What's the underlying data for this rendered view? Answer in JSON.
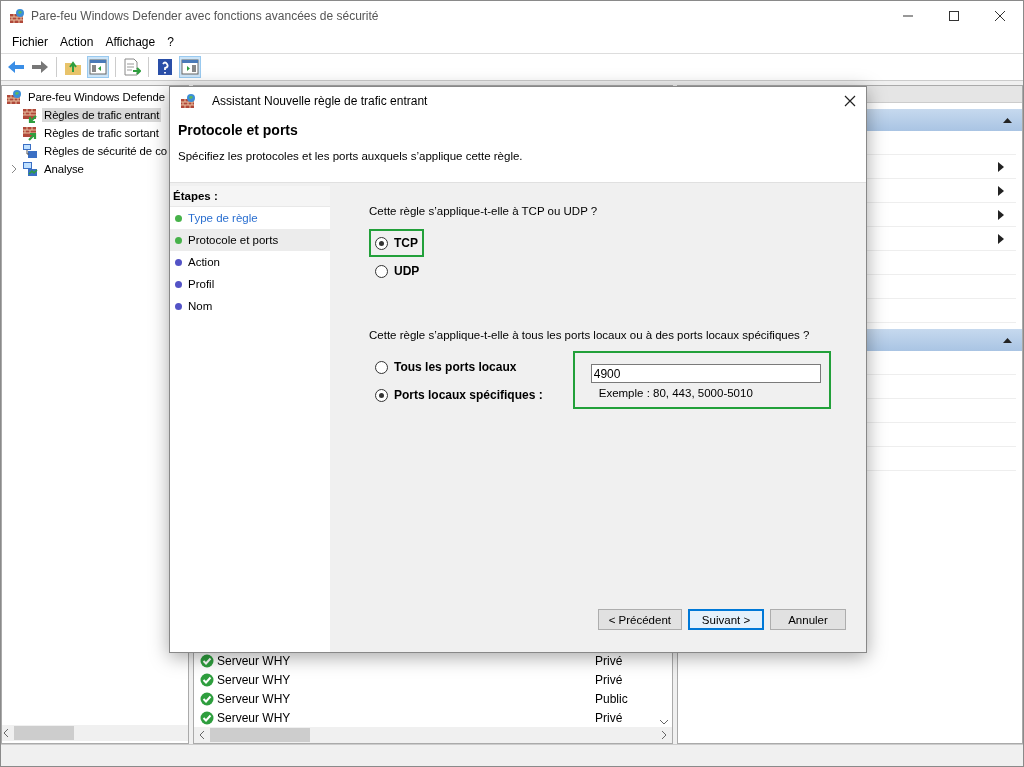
{
  "window": {
    "title": "Pare-feu Windows Defender avec fonctions avancées de sécurité"
  },
  "menu": [
    "Fichier",
    "Action",
    "Affichage",
    "?"
  ],
  "tree": {
    "label": "Pare-feu Windows Defende",
    "children": [
      {
        "label": "Règles de trafic entrant",
        "selected": true,
        "expandable": false
      },
      {
        "label": "Règles de trafic sortant",
        "selected": false,
        "expandable": false
      },
      {
        "label": "Règles de sécurité de co",
        "selected": false,
        "expandable": false
      },
      {
        "label": "Analyse",
        "selected": false,
        "expandable": true
      }
    ]
  },
  "rules": [
    {
      "name": "Serveur WHY",
      "profile": "Privé"
    },
    {
      "name": "Serveur WHY",
      "profile": "Privé"
    },
    {
      "name": "Serveur WHY",
      "profile": "Public"
    },
    {
      "name": "Serveur WHY",
      "profile": "Privé"
    }
  ],
  "actions": [
    {
      "expanded": true,
      "rows": [
        {
          "submenu": false
        },
        {
          "submenu": true
        },
        {
          "submenu": true
        },
        {
          "submenu": true
        },
        {
          "submenu": true
        },
        {
          "submenu": false
        },
        {
          "submenu": false
        },
        {
          "submenu": false
        }
      ]
    },
    {
      "expanded": true,
      "rows": [
        {
          "submenu": false
        },
        {
          "submenu": false
        },
        {
          "submenu": false
        },
        {
          "submenu": false
        },
        {
          "submenu": false
        }
      ]
    }
  ],
  "dialog": {
    "title": "Assistant Nouvelle règle de trafic entrant",
    "heading": "Protocole et ports",
    "description": "Spécifiez les protocoles et les ports auxquels s’applique cette règle.",
    "steps_label": "Étapes :",
    "steps": [
      {
        "label": "Type de règle",
        "completed": true,
        "selected": false
      },
      {
        "label": "Protocole et ports",
        "completed": true,
        "selected": true
      },
      {
        "label": "Action",
        "completed": false,
        "selected": false
      },
      {
        "label": "Profil",
        "completed": false,
        "selected": false
      },
      {
        "label": "Nom",
        "completed": false,
        "selected": false
      }
    ],
    "protocol_question": "Cette règle s’applique-t-elle à TCP ou UDP ?",
    "protocols": [
      {
        "label": "TCP",
        "selected": true,
        "highlighted": true
      },
      {
        "label": "UDP",
        "selected": false,
        "highlighted": false
      }
    ],
    "ports_question": "Cette règle s’applique-t-elle à tous les ports locaux ou à des ports locaux spécifiques ?",
    "port_options": [
      {
        "label": "Tous les ports locaux",
        "selected": false
      },
      {
        "label": "Ports locaux spécifiques :",
        "selected": true
      }
    ],
    "ports_value": "4900",
    "ports_example": "Exemple : 80, 443, 5000-5010",
    "ports_highlighted": true,
    "buttons": [
      {
        "label": "< Précédent",
        "default": false
      },
      {
        "label": "Suivant >",
        "default": true
      },
      {
        "label": "Annuler",
        "default": false
      }
    ]
  }
}
